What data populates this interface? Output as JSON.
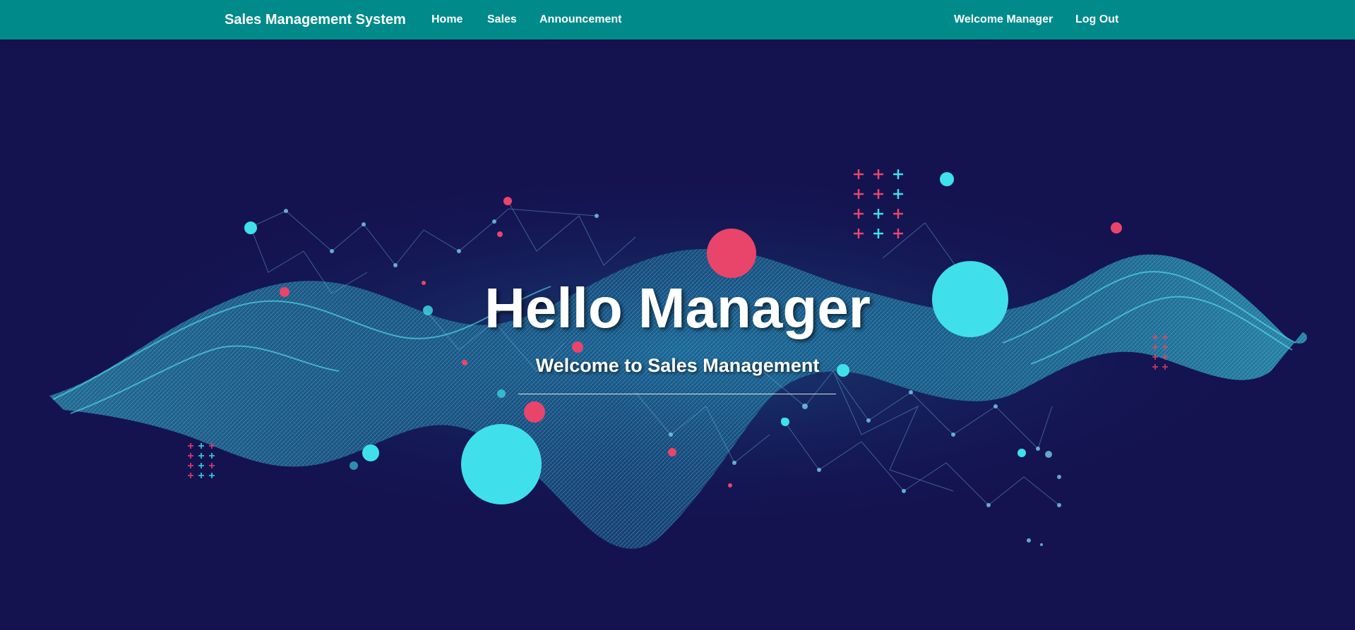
{
  "navbar": {
    "brand": "Sales Management System",
    "links": [
      "Home",
      "Sales",
      "Announcement"
    ],
    "welcome": "Welcome Manager",
    "logout": "Log Out",
    "color": "#018a8a"
  },
  "hero": {
    "title": "Hello Manager",
    "subtitle": "Welcome to Sales Management",
    "background_color": "#141350",
    "accent_cyan": "#3fe0ec",
    "accent_pink": "#e9456a",
    "background_image": "network-wave-illustration"
  }
}
